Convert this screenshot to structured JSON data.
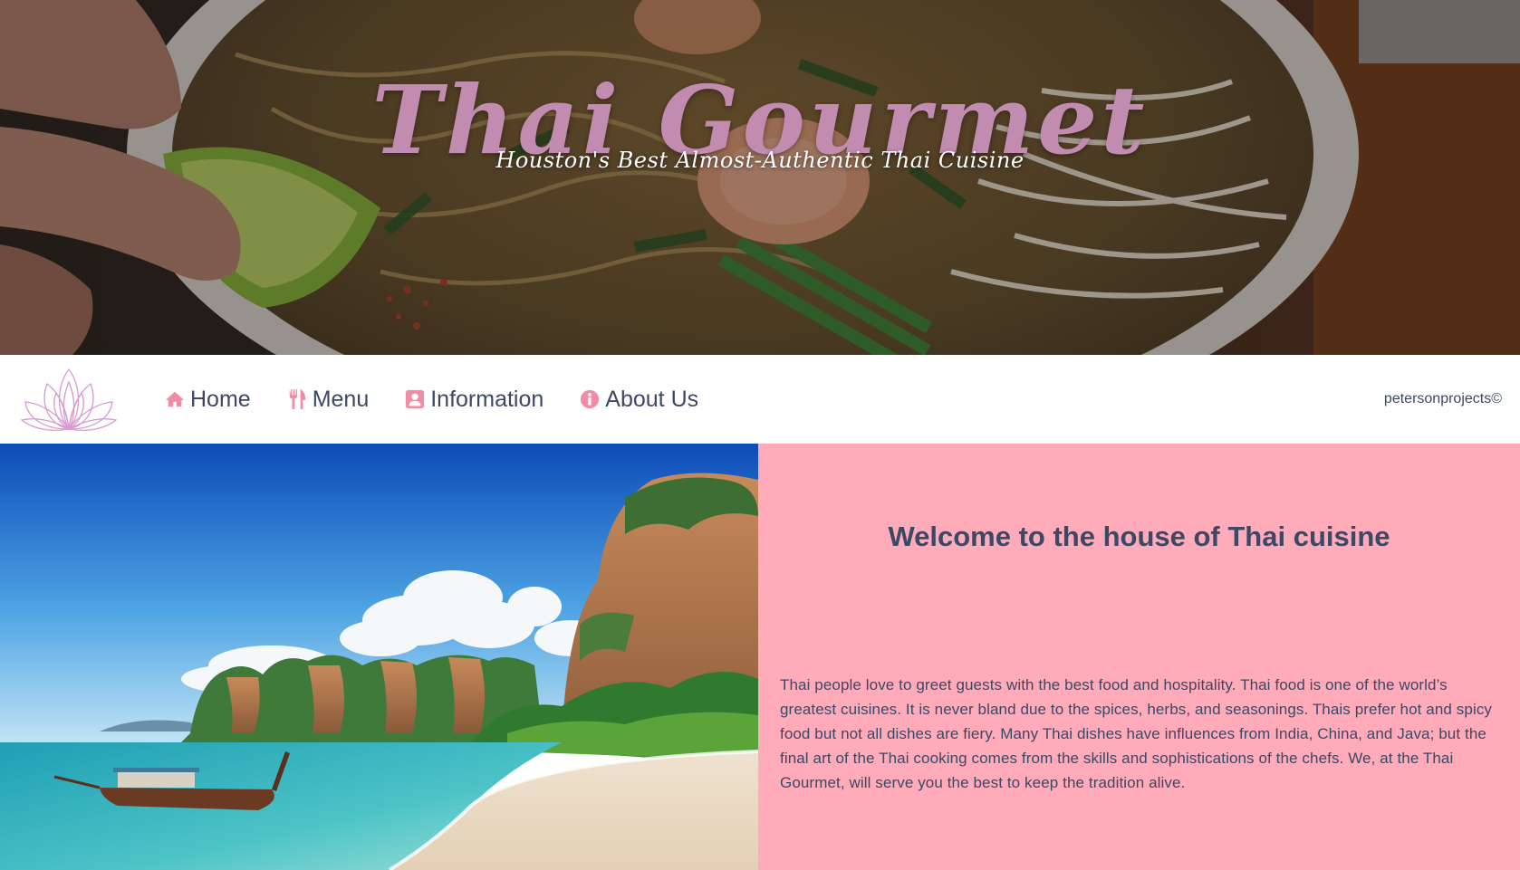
{
  "hero": {
    "title": "Thai Gourmet",
    "subtitle": "Houston's Best Almost-Authentic Thai Cuisine"
  },
  "nav": {
    "items": [
      {
        "label": "Home",
        "icon": "home-icon"
      },
      {
        "label": "Menu",
        "icon": "cutlery-icon"
      },
      {
        "label": "Information",
        "icon": "user-card-icon"
      },
      {
        "label": "About Us",
        "icon": "info-icon"
      }
    ],
    "icon_color": "#f08ca4",
    "copyright": "petersonprojects©"
  },
  "welcome": {
    "heading": "Welcome to the house of Thai cuisine",
    "body": "Thai people love to greet guests with the best food and hospitality. Thai food is one of the world’s greatest cuisines. It is never bland due to the spices, herbs, and seasonings. Thais prefer hot and spicy food but not all dishes are fiery. Many Thai dishes have influences from India, China, and Java; but the final art of the Thai cooking comes from the skills and sophistications of the chefs. We, at the Thai Gourmet, will serve you the best to keep the tradition alive."
  },
  "colors": {
    "panel_pink": "#ffabb9",
    "title_mauve": "#c28bb0",
    "navy_text": "#3b4866"
  }
}
